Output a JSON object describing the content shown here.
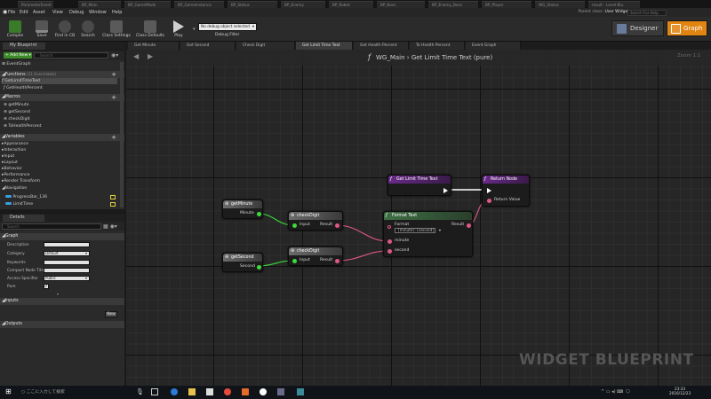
{
  "file_tabs": [
    {
      "label": "ParameterEvent",
      "active": false
    },
    {
      "label": "BP_Main",
      "active": false
    },
    {
      "label": "BP_GameMode",
      "active": false
    },
    {
      "label": "BP_GameInstance",
      "active": false
    },
    {
      "label": "BP_Status",
      "active": false
    },
    {
      "label": "BP_Enemy",
      "active": false
    },
    {
      "label": "BP_Robot",
      "active": false
    },
    {
      "label": "BP_Boss",
      "active": false
    },
    {
      "label": "BP_Enemy_Boss",
      "active": false
    },
    {
      "label": "BP_Player",
      "active": false
    },
    {
      "label": "WG_Status",
      "active": false
    },
    {
      "label": "result - Level Blu",
      "active": false
    }
  ],
  "menu": [
    "File",
    "Edit",
    "Asset",
    "View",
    "Debug",
    "Window",
    "Help"
  ],
  "parent_class": {
    "label": "Parent class:",
    "value": "User Widget"
  },
  "search_help_placeholder": "Search For Help",
  "toolbar": {
    "buttons": [
      {
        "label": "Compile",
        "color": "#3a7a2a"
      },
      {
        "label": "Save",
        "color": "#4a4a4a"
      },
      {
        "label": "Find in CB",
        "color": "#4a4a4a"
      },
      {
        "label": "Search",
        "color": "#4a4a4a"
      },
      {
        "label": "Class Settings",
        "color": "#4a4a4a"
      },
      {
        "label": "Class Defaults",
        "color": "#4a4a4a"
      },
      {
        "label": "Play",
        "color": "#4a4a4a"
      }
    ],
    "debug_selected": "No debug object selected",
    "debug_label": "Debug Filter",
    "designer": "Designer",
    "graph": "Graph"
  },
  "my_blueprint": {
    "tab": "My Blueprint",
    "add_new": "Add New",
    "search_placeholder": "Search",
    "event_graph": "EventGraph",
    "functions_label": "Functions",
    "functions_sub": "(21 Overridable)",
    "functions": [
      "GetLimitTimeText",
      "GetHealthPercent"
    ],
    "macros_label": "Macros",
    "macros": [
      "getMinute",
      "getSecond",
      "checkDigit",
      "ToHealthPercent"
    ],
    "variables_label": "Variables",
    "var_categories": [
      "Appearance",
      "Interaction",
      "Input",
      "Layout",
      "Behavior",
      "Performance",
      "Render Transform",
      "Navigation"
    ],
    "variables": [
      "ProgressBar_136",
      "LimitTime"
    ]
  },
  "details": {
    "tab": "Details",
    "search_placeholder": "Search",
    "section_graph": "Graph",
    "fields": {
      "description": "Description",
      "category": "Category",
      "category_value": "Default",
      "keywords": "Keywords",
      "compact_title": "Compact Node Title",
      "access": "Access Specifier",
      "access_value": "Public",
      "pure": "Pure"
    },
    "inputs": "Inputs",
    "new": "New",
    "outputs": "Outputs"
  },
  "graph_tabs": [
    {
      "label": "Get Minute",
      "active": false
    },
    {
      "label": "Get Second",
      "active": false
    },
    {
      "label": "Check Digit",
      "active": false
    },
    {
      "label": "Get Limit Time Text",
      "active": true
    },
    {
      "label": "Get Health Percent",
      "active": false
    },
    {
      "label": "To Health Percent",
      "active": false
    },
    {
      "label": "Event Graph",
      "active": false
    }
  ],
  "breadcrumb": {
    "root": "WG_Main",
    "sep": "›",
    "current": "Get Limit Time Text (pure)"
  },
  "zoom": "Zoom 1:1",
  "watermark": "WIDGET BLUEPRINT",
  "nodes": {
    "entry": {
      "title": "Get Limit Time Text"
    },
    "return": {
      "title": "Return Node",
      "pin": "Return Value"
    },
    "get_minute": {
      "title": "getMinute",
      "pin": "Minute"
    },
    "get_second": {
      "title": "getSecond",
      "pin": "Second"
    },
    "check_digit_1": {
      "title": "checkDigit",
      "in": "Input",
      "out": "Result"
    },
    "check_digit_2": {
      "title": "checkDigit",
      "in": "Input",
      "out": "Result"
    },
    "format_text": {
      "title": "Format Text",
      "format_label": "Format",
      "format_value": "{minute}:{second}",
      "result": "Result",
      "pin_minute": "minute",
      "pin_second": "second"
    }
  },
  "colors": {
    "text_pin": "#e0578a",
    "int_pin": "#3ddc3d",
    "function_header": "#6a2a8a",
    "macro_header": "#6b6b6b",
    "format_header": "#3f6f44",
    "accent": "#e08412"
  },
  "taskbar": {
    "search": "ここに入力して検索",
    "time": "23:33",
    "date": "2016/12/23"
  }
}
